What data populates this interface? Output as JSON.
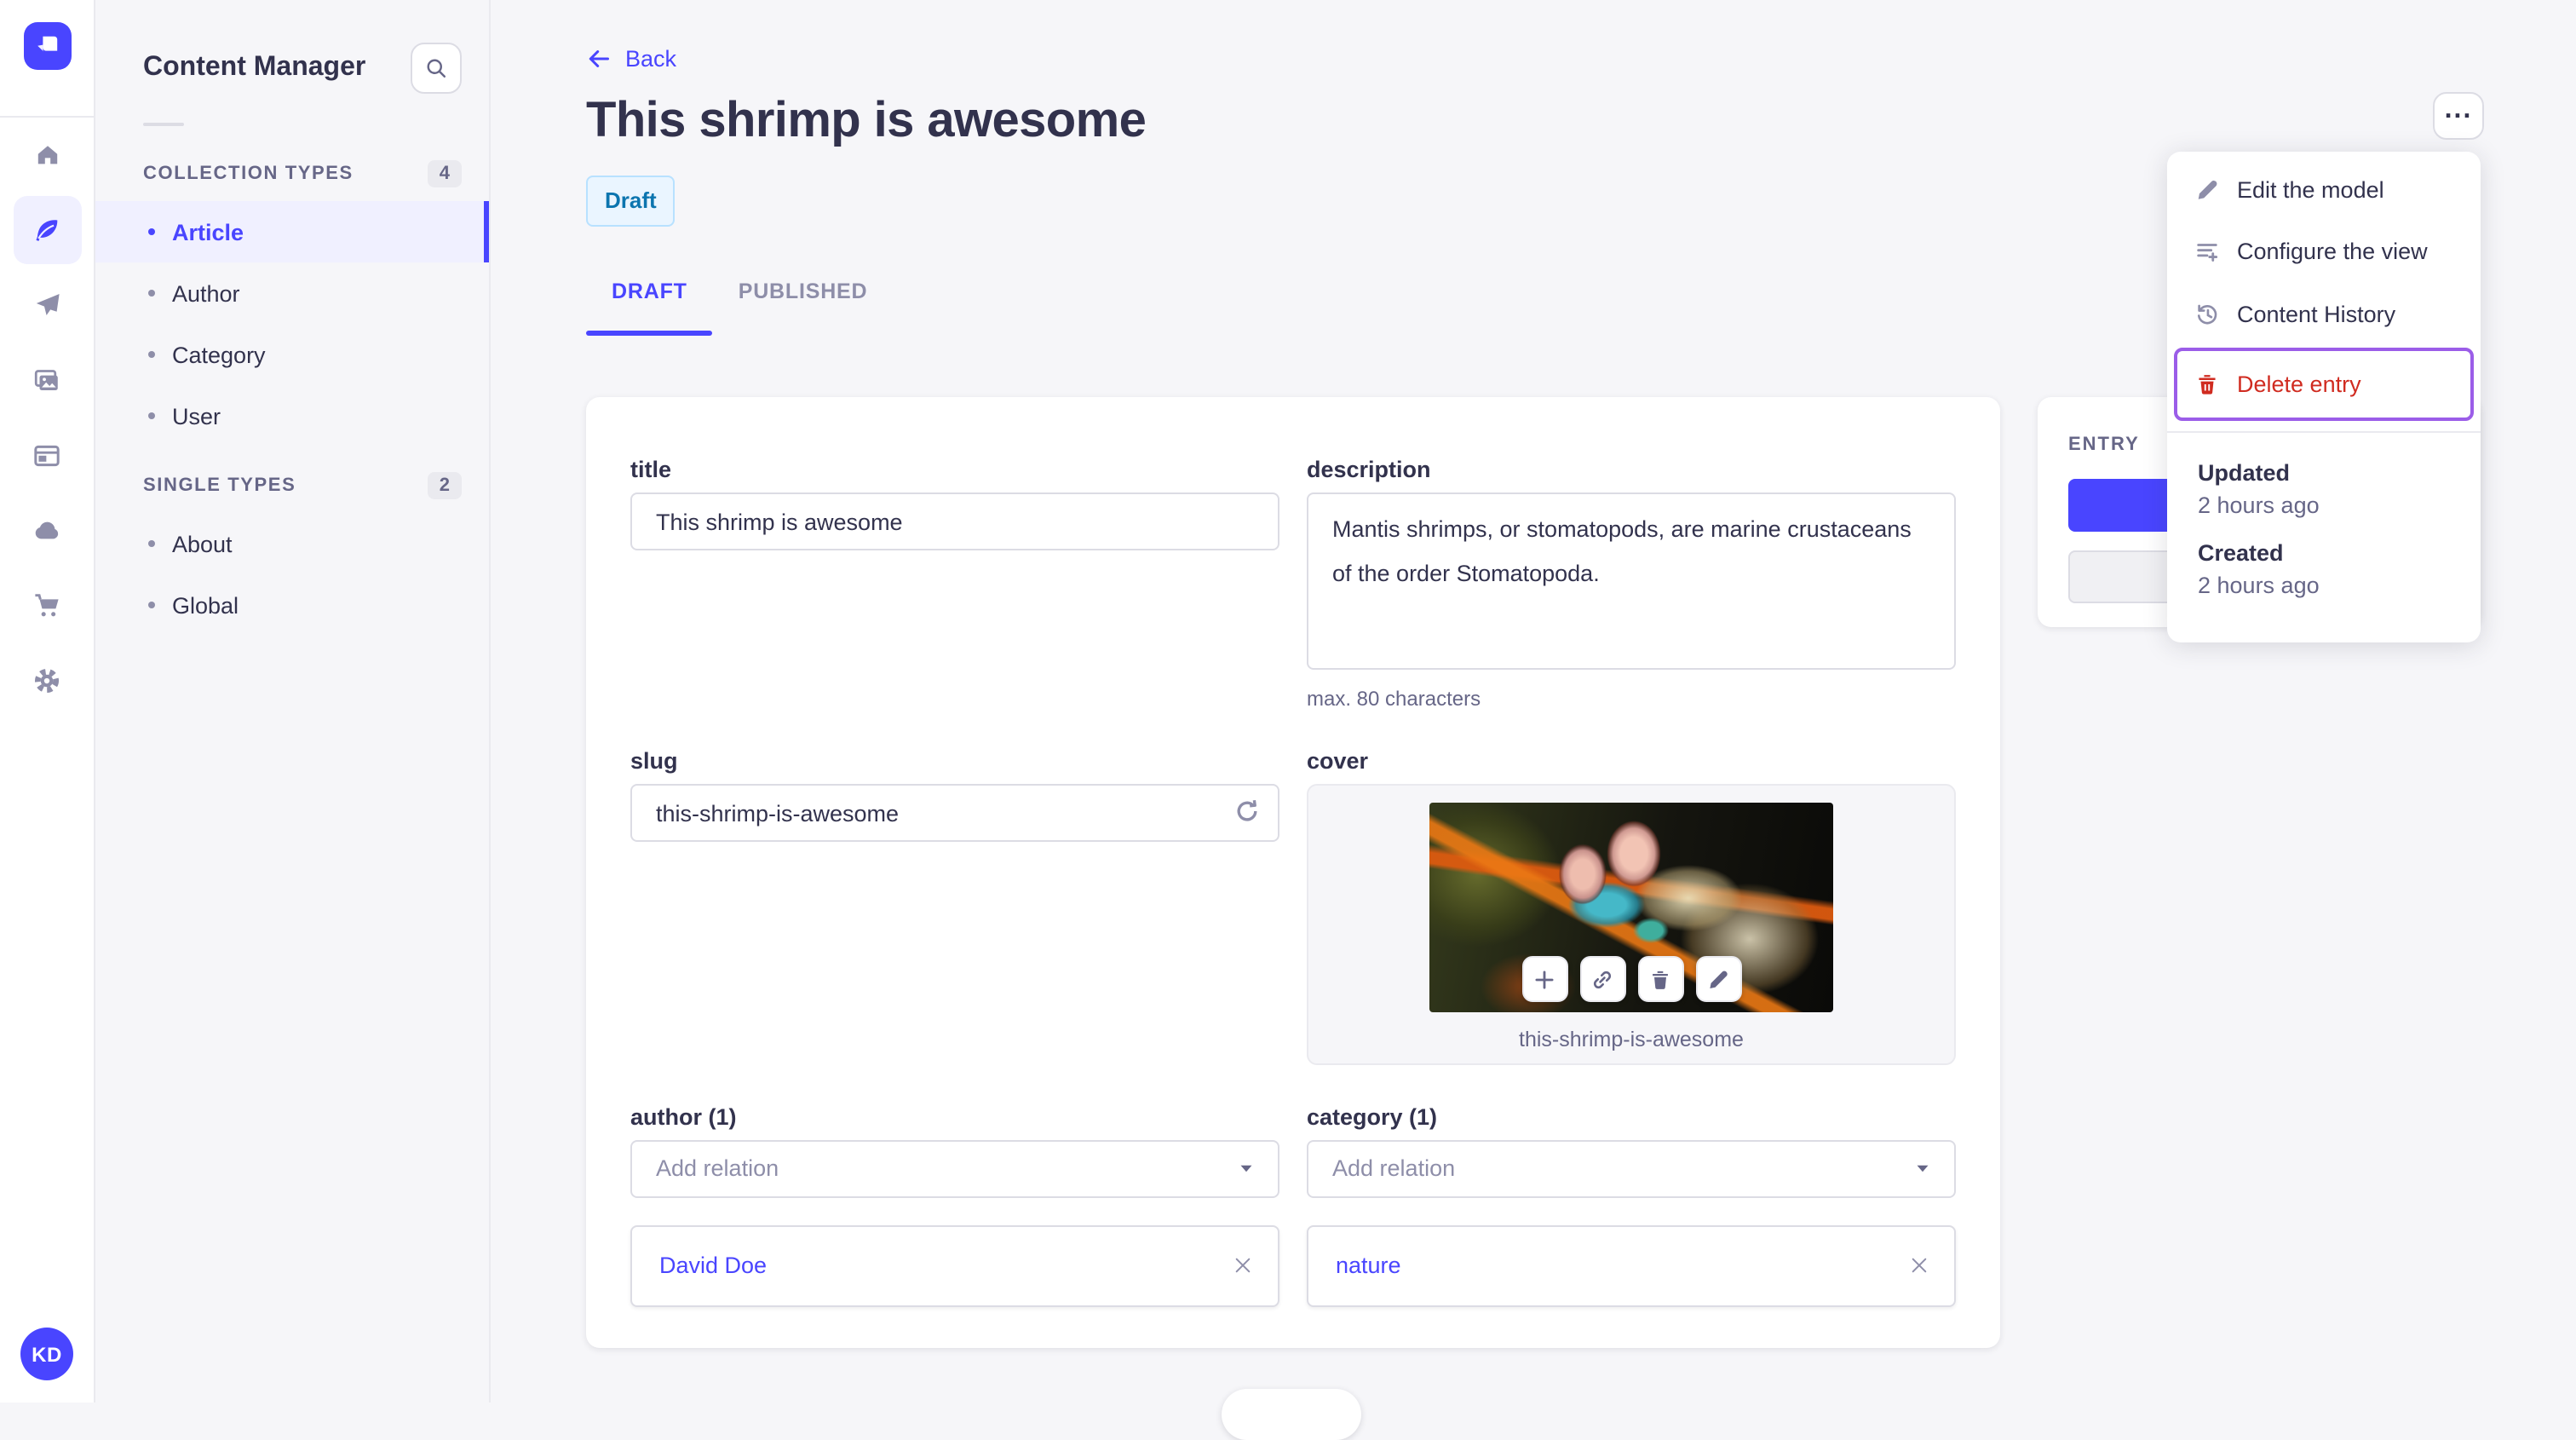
{
  "colors": {
    "accent": "#4945ff",
    "accent_light_bg": "#f0f0ff",
    "danger": "#d02b20",
    "highlight_outline": "#9b5de8",
    "draft_badge_bg": "#eaf5ff",
    "draft_badge_border": "#b8e1ff",
    "draft_badge_text": "#0c75af",
    "page_bg": "#f6f6f9"
  },
  "rail": {
    "logo_icon": "strapi-logo",
    "icons": [
      "home-icon",
      "content-manager-feather-icon",
      "releases-plane-icon",
      "media-library-icon",
      "content-type-builder-icon",
      "deploy-cloud-icon",
      "marketplace-cart-icon",
      "settings-gear-icon"
    ],
    "active_icon": "content-manager-feather-icon",
    "avatar_initials": "KD"
  },
  "subnav": {
    "title": "Content Manager",
    "search_icon": "search-icon",
    "sections": [
      {
        "label": "COLLECTION TYPES",
        "count": "4",
        "items": [
          {
            "label": "Article",
            "active": true
          },
          {
            "label": "Author"
          },
          {
            "label": "Category"
          },
          {
            "label": "User"
          }
        ]
      },
      {
        "label": "SINGLE TYPES",
        "count": "2",
        "items": [
          {
            "label": "About"
          },
          {
            "label": "Global"
          }
        ]
      }
    ]
  },
  "header": {
    "back_label": "Back",
    "title": "This shrimp is awesome",
    "status_badge": "Draft",
    "tabs": [
      {
        "label": "DRAFT",
        "active": true
      },
      {
        "label": "PUBLISHED"
      }
    ],
    "more_button": "...",
    "more_icon": "ellipsis-icon"
  },
  "form": {
    "title": {
      "label": "title",
      "value": "This shrimp is awesome"
    },
    "description": {
      "label": "description",
      "value": "Mantis shrimps, or stomatopods, are marine crustaceans of the order Stomatopoda.",
      "helper": "max. 80 characters"
    },
    "slug": {
      "label": "slug",
      "value": "this-shrimp-is-awesome",
      "icon": "regenerate-icon"
    },
    "cover": {
      "label": "cover",
      "caption": "this-shrimp-is-awesome",
      "actions": [
        "add-asset-icon",
        "copy-link-icon",
        "delete-asset-icon",
        "edit-asset-icon"
      ]
    },
    "author": {
      "label": "author (1)",
      "placeholder": "Add relation",
      "relations": [
        {
          "name": "David Doe"
        }
      ]
    },
    "category": {
      "label": "category (1)",
      "placeholder": "Add relation",
      "relations": [
        {
          "name": "nature"
        }
      ]
    }
  },
  "entry_panel": {
    "title": "ENTRY"
  },
  "menu": {
    "items": [
      {
        "label": "Edit the model",
        "icon": "pencil-icon"
      },
      {
        "label": "Configure the view",
        "icon": "list-plus-icon"
      },
      {
        "label": "Content History",
        "icon": "history-icon"
      },
      {
        "label": "Delete entry",
        "icon": "trash-icon",
        "danger": true,
        "highlighted": true
      }
    ],
    "meta": [
      {
        "label": "Updated",
        "value": "2 hours ago"
      },
      {
        "label": "Created",
        "value": "2 hours ago"
      }
    ]
  }
}
